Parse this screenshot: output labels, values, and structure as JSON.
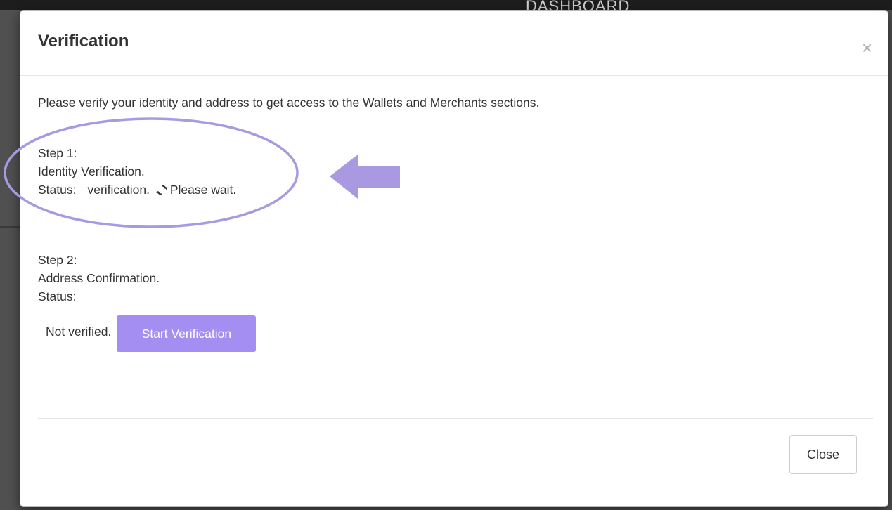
{
  "backdrop": {
    "peek_text": "DASHBOARD"
  },
  "modal": {
    "title": "Verification",
    "close_glyph": "×",
    "intro": "Please verify your identity and address to get access to the Wallets and Merchants sections.",
    "step1": {
      "heading": "Step 1:",
      "name": "Identity Verification.",
      "status_label": "Status:",
      "status_value": "verification.",
      "spinner_icon": "refresh-icon",
      "wait_text": "Please wait."
    },
    "step2": {
      "heading": "Step 2:",
      "name": "Address Confirmation.",
      "status_label": "Status:",
      "status_value": "Not verified.",
      "button_label": "Start Verification"
    },
    "footer": {
      "close_label": "Close"
    }
  },
  "colors": {
    "accent": "#a58ef2",
    "annotation": "#a999e0"
  }
}
